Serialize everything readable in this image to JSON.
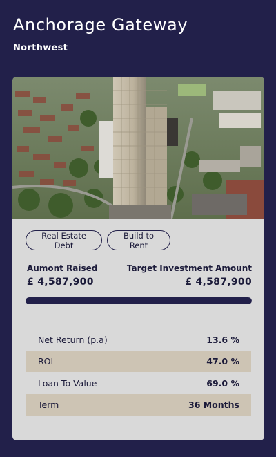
{
  "header": {
    "title": "Anchorage Gateway",
    "subtitle": "Northwest"
  },
  "tags": [
    "Real Estate Debt",
    "Build to Rent"
  ],
  "funding": {
    "raised_label": "Aumont Raised",
    "raised_value": "£ 4,587,900",
    "target_label": "Target Investment Amount",
    "target_value": "£ 4,587,900",
    "progress_fraction": 1.0
  },
  "metrics": [
    {
      "label": "Net Return (p.a)",
      "value": "13.6 %"
    },
    {
      "label": "ROI",
      "value": "47.0 %"
    },
    {
      "label": "Loan To Value",
      "value": "69.0 %"
    },
    {
      "label": "Term",
      "value": "36 Months"
    }
  ],
  "colors": {
    "background": "#22204a",
    "card": "#d9d9d9",
    "row_shade": "#cdc4b4",
    "progress": "#22204a"
  }
}
